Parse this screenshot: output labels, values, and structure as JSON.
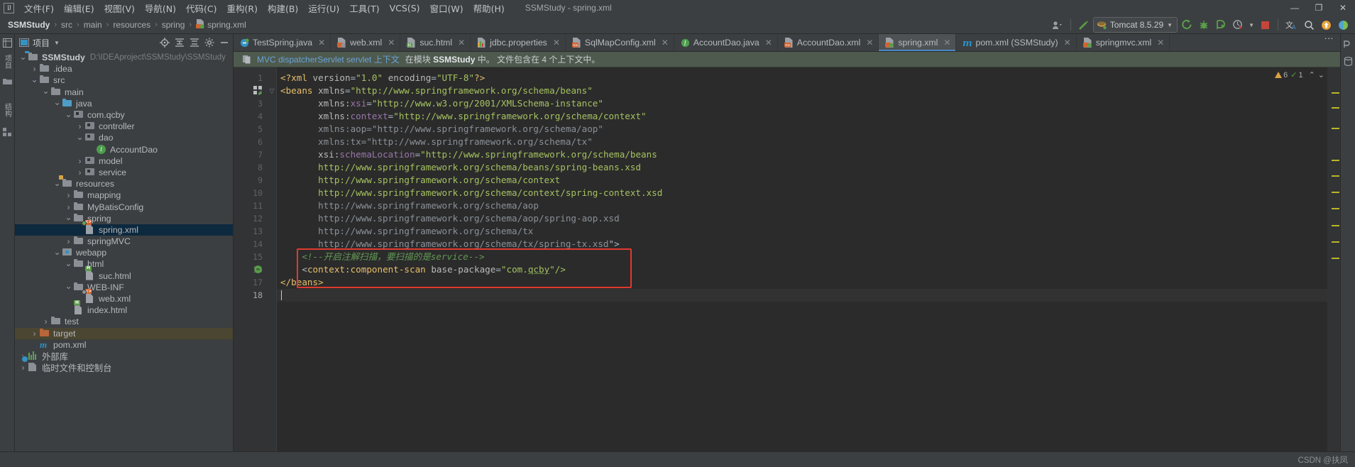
{
  "window": {
    "title": "SSMStudy - spring.xml",
    "logo": "intellij-idea-logo",
    "controls": {
      "minimize": "—",
      "maximize": "❐",
      "close": "✕"
    }
  },
  "menubar": {
    "items": [
      {
        "label": "文件(F)",
        "name": "menu-file"
      },
      {
        "label": "编辑(E)",
        "name": "menu-edit"
      },
      {
        "label": "视图(V)",
        "name": "menu-view"
      },
      {
        "label": "导航(N)",
        "name": "menu-navigate"
      },
      {
        "label": "代码(C)",
        "name": "menu-code"
      },
      {
        "label": "重构(R)",
        "name": "menu-refactor"
      },
      {
        "label": "构建(B)",
        "name": "menu-build"
      },
      {
        "label": "运行(U)",
        "name": "menu-run"
      },
      {
        "label": "工具(T)",
        "name": "menu-tools"
      },
      {
        "label": "VCS(S)",
        "name": "menu-vcs"
      },
      {
        "label": "窗口(W)",
        "name": "menu-window"
      },
      {
        "label": "帮助(H)",
        "name": "menu-help"
      }
    ]
  },
  "breadcrumb": {
    "items": [
      "SSMStudy",
      "src",
      "main",
      "resources",
      "spring",
      "spring.xml"
    ],
    "separator": "›"
  },
  "toolbar": {
    "run_config": "Tomcat 8.5.29",
    "buttons": [
      {
        "name": "user-settings-icon",
        "glyph": "⛭"
      },
      {
        "name": "build-hammer-icon",
        "glyph": "⚒"
      },
      {
        "name": "run-button",
        "glyph": "▶"
      },
      {
        "name": "debug-button",
        "glyph": "🐞"
      },
      {
        "name": "run-with-coverage-button",
        "glyph": "▷"
      },
      {
        "name": "profiler-button",
        "glyph": "◴"
      },
      {
        "name": "stop-button",
        "glyph": "■"
      },
      {
        "name": "translate-icon",
        "glyph": "文"
      },
      {
        "name": "search-everywhere-icon",
        "glyph": "🔍"
      },
      {
        "name": "update-available-icon",
        "glyph": "↑"
      },
      {
        "name": "theme-toggle-icon",
        "glyph": "◐"
      }
    ]
  },
  "left_tool_strip": {
    "items": [
      {
        "name": "sidebar-item-project",
        "label": "项目"
      },
      {
        "name": "sidebar-item-structure",
        "label": "结构"
      }
    ]
  },
  "right_tool_strip": {
    "items": [
      {
        "name": "sidebar-item-maven",
        "label": "Maven"
      },
      {
        "name": "sidebar-item-database",
        "label": "Database"
      }
    ]
  },
  "project_panel": {
    "title": "项目",
    "actions": [
      {
        "name": "locate-in-tree-icon",
        "glyph": "⊕"
      },
      {
        "name": "expand-all-icon",
        "glyph": "≣"
      },
      {
        "name": "collapse-all-icon",
        "glyph": "≡"
      },
      {
        "name": "settings-gear-icon",
        "glyph": "⚙"
      },
      {
        "name": "hide-panel-icon",
        "glyph": "—"
      }
    ],
    "tree": [
      {
        "label": "SSMStudy",
        "path": "D:\\IDEAproject\\SSMStudy\\SSMStudy",
        "depth": 0,
        "arrow": "down",
        "icon": "module-folder",
        "bold": true,
        "state": "normal"
      },
      {
        "label": ".idea",
        "depth": 1,
        "arrow": "right",
        "icon": "folder",
        "state": "normal"
      },
      {
        "label": "src",
        "depth": 1,
        "arrow": "down",
        "icon": "folder",
        "state": "normal"
      },
      {
        "label": "main",
        "depth": 2,
        "arrow": "down",
        "icon": "folder",
        "state": "normal"
      },
      {
        "label": "java",
        "depth": 3,
        "arrow": "down",
        "icon": "source-folder",
        "state": "normal"
      },
      {
        "label": "com.qcby",
        "depth": 4,
        "arrow": "down",
        "icon": "package",
        "state": "normal"
      },
      {
        "label": "controller",
        "depth": 5,
        "arrow": "right",
        "icon": "package",
        "state": "normal"
      },
      {
        "label": "dao",
        "depth": 5,
        "arrow": "down",
        "icon": "package",
        "state": "normal"
      },
      {
        "label": "AccountDao",
        "depth": 6,
        "arrow": "none",
        "icon": "interface",
        "state": "normal"
      },
      {
        "label": "model",
        "depth": 5,
        "arrow": "right",
        "icon": "package",
        "state": "normal"
      },
      {
        "label": "service",
        "depth": 5,
        "arrow": "right",
        "icon": "package",
        "state": "normal"
      },
      {
        "label": "resources",
        "depth": 3,
        "arrow": "down",
        "icon": "resources-folder",
        "state": "normal"
      },
      {
        "label": "mapping",
        "depth": 4,
        "arrow": "right",
        "icon": "folder",
        "state": "normal"
      },
      {
        "label": "MyBatisConfig",
        "depth": 4,
        "arrow": "right",
        "icon": "folder",
        "state": "normal"
      },
      {
        "label": "spring",
        "depth": 4,
        "arrow": "down",
        "icon": "folder",
        "state": "normal"
      },
      {
        "label": "spring.xml",
        "depth": 5,
        "arrow": "none",
        "icon": "xml-spring-file",
        "state": "selected"
      },
      {
        "label": "springMVC",
        "depth": 4,
        "arrow": "right",
        "icon": "folder",
        "state": "normal"
      },
      {
        "label": "webapp",
        "depth": 3,
        "arrow": "down",
        "icon": "web-folder",
        "state": "normal"
      },
      {
        "label": "html",
        "depth": 4,
        "arrow": "down",
        "icon": "folder",
        "state": "normal"
      },
      {
        "label": "suc.html",
        "depth": 5,
        "arrow": "none",
        "icon": "html-file",
        "state": "normal"
      },
      {
        "label": "WEB-INF",
        "depth": 4,
        "arrow": "down",
        "icon": "folder",
        "state": "normal"
      },
      {
        "label": "web.xml",
        "depth": 5,
        "arrow": "none",
        "icon": "xml-web-file",
        "state": "normal"
      },
      {
        "label": "index.html",
        "depth": 4,
        "arrow": "none",
        "icon": "html-file",
        "state": "normal"
      },
      {
        "label": "test",
        "depth": 2,
        "arrow": "right",
        "icon": "folder",
        "state": "normal"
      },
      {
        "label": "target",
        "depth": 1,
        "arrow": "right",
        "icon": "excluded-folder",
        "state": "marked"
      },
      {
        "label": "pom.xml",
        "depth": 1,
        "arrow": "none",
        "icon": "maven-file",
        "state": "normal"
      },
      {
        "label": "外部库",
        "depth": 0,
        "arrow": "right",
        "icon": "libraries",
        "state": "normal"
      },
      {
        "label": "临时文件和控制台",
        "depth": 0,
        "arrow": "right",
        "icon": "scratches",
        "state": "normal"
      }
    ]
  },
  "editor_tabs": [
    {
      "label": "TestSpring.java",
      "icon": "java-class-test-icon",
      "active": false
    },
    {
      "label": "web.xml",
      "icon": "xml-web-icon",
      "active": false
    },
    {
      "label": "suc.html",
      "icon": "html-icon",
      "active": false
    },
    {
      "label": "jdbc.properties",
      "icon": "properties-icon",
      "active": false
    },
    {
      "label": "SqlMapConfig.xml",
      "icon": "xml-mybatis-icon",
      "active": false
    },
    {
      "label": "AccountDao.java",
      "icon": "java-interface-icon",
      "active": false
    },
    {
      "label": "AccountDao.xml",
      "icon": "xml-mapper-icon",
      "active": false
    },
    {
      "label": "spring.xml",
      "icon": "xml-spring-icon",
      "active": true
    },
    {
      "label": "pom.xml (SSMStudy)",
      "icon": "maven-icon",
      "active": false
    },
    {
      "label": "springmvc.xml",
      "icon": "xml-spring-icon",
      "active": false
    }
  ],
  "notice_bar": {
    "icon": "spring-context-icon",
    "link": "MVC dispatcherServlet servlet 上下文",
    "text_prefix": "在模块 ",
    "module": "SSMStudy",
    "text_suffix": " 中。 文件包含在 4 个上下文中。"
  },
  "inspection_widget": {
    "warnings": "6",
    "checks": "1",
    "up_arrow": "⌃",
    "down_arrow": "⌄"
  },
  "editor": {
    "caret_line": 18,
    "highlight_box": {
      "from_line": 15,
      "to_line": 17
    },
    "lines": [
      {
        "n": 1,
        "tokens": [
          {
            "t": "<?xml ",
            "c": "t-tag"
          },
          {
            "t": "version",
            "c": "t-attr"
          },
          {
            "t": "=",
            "c": "t-punct"
          },
          {
            "t": "\"1.0\"",
            "c": "t-val"
          },
          {
            "t": " ",
            "c": "t-plain"
          },
          {
            "t": "encoding",
            "c": "t-attr"
          },
          {
            "t": "=",
            "c": "t-punct"
          },
          {
            "t": "\"UTF-8\"",
            "c": "t-val"
          },
          {
            "t": "?>",
            "c": "t-tag"
          }
        ]
      },
      {
        "n": 2,
        "tokens": [
          {
            "t": "<beans ",
            "c": "t-tag"
          },
          {
            "t": "xmlns",
            "c": "t-attr"
          },
          {
            "t": "=",
            "c": "t-punct"
          },
          {
            "t": "\"http://www.springframework.org/schema/beans\"",
            "c": "t-val"
          }
        ]
      },
      {
        "n": 3,
        "tokens": [
          {
            "t": "       ",
            "c": "t-plain"
          },
          {
            "t": "xmlns:",
            "c": "t-attr"
          },
          {
            "t": "xsi",
            "c": "t-attr-ns"
          },
          {
            "t": "=",
            "c": "t-punct"
          },
          {
            "t": "\"http://www.w3.org/2001/XMLSchema-instance\"",
            "c": "t-val"
          }
        ]
      },
      {
        "n": 4,
        "tokens": [
          {
            "t": "       ",
            "c": "t-plain"
          },
          {
            "t": "xmlns:",
            "c": "t-attr"
          },
          {
            "t": "context",
            "c": "t-attr-ns"
          },
          {
            "t": "=",
            "c": "t-punct"
          },
          {
            "t": "\"http://www.springframework.org/schema/context\"",
            "c": "t-val"
          }
        ]
      },
      {
        "n": 5,
        "tokens": [
          {
            "t": "       ",
            "c": "t-plain"
          },
          {
            "t": "xmlns:aop",
            "c": "t-url"
          },
          {
            "t": "=",
            "c": "t-url"
          },
          {
            "t": "\"http://www.springframework.org/schema/aop\"",
            "c": "t-url"
          }
        ]
      },
      {
        "n": 6,
        "tokens": [
          {
            "t": "       ",
            "c": "t-plain"
          },
          {
            "t": "xmlns:tx",
            "c": "t-url"
          },
          {
            "t": "=",
            "c": "t-url"
          },
          {
            "t": "\"http://www.springframework.org/schema/tx\"",
            "c": "t-url"
          }
        ]
      },
      {
        "n": 7,
        "tokens": [
          {
            "t": "       ",
            "c": "t-plain"
          },
          {
            "t": "xsi:",
            "c": "t-attr"
          },
          {
            "t": "schemaLocation",
            "c": "t-attr-ns"
          },
          {
            "t": "=",
            "c": "t-punct"
          },
          {
            "t": "\"http://www.springframework.org/schema/beans",
            "c": "t-val"
          }
        ]
      },
      {
        "n": 8,
        "tokens": [
          {
            "t": "       http://www.springframework.org/schema/beans/spring-beans.xsd",
            "c": "t-val"
          }
        ]
      },
      {
        "n": 9,
        "tokens": [
          {
            "t": "       http://www.springframework.org/schema/context",
            "c": "t-val"
          }
        ]
      },
      {
        "n": 10,
        "tokens": [
          {
            "t": "       http://www.springframework.org/schema/context/spring-context.xsd",
            "c": "t-val"
          }
        ]
      },
      {
        "n": 11,
        "tokens": [
          {
            "t": "       http://www.springframework.org/schema/aop",
            "c": "t-url"
          }
        ]
      },
      {
        "n": 12,
        "tokens": [
          {
            "t": "       http://www.springframework.org/schema/aop/spring-aop.xsd",
            "c": "t-url"
          }
        ]
      },
      {
        "n": 13,
        "tokens": [
          {
            "t": "       http://www.springframework.org/schema/tx",
            "c": "t-url"
          }
        ]
      },
      {
        "n": 14,
        "tokens": [
          {
            "t": "       http://www.springframework.org/schema/tx/spring-tx.xsd",
            "c": "t-url"
          },
          {
            "t": "\">",
            "c": "t-punct"
          }
        ]
      },
      {
        "n": 15,
        "tokens": [
          {
            "t": "    ",
            "c": "t-plain"
          },
          {
            "t": "<!--开启注解扫描，要扫描的是service-->",
            "c": "t-comment"
          }
        ]
      },
      {
        "n": 16,
        "tokens": [
          {
            "t": "    ",
            "c": "t-plain"
          },
          {
            "t": "<",
            "c": "t-punct"
          },
          {
            "t": "context:component-scan ",
            "c": "t-tag"
          },
          {
            "t": "base-package",
            "c": "t-attr"
          },
          {
            "t": "=",
            "c": "t-punct"
          },
          {
            "t": "\"com.",
            "c": "t-val"
          },
          {
            "t": "qcby",
            "c": "t-underline"
          },
          {
            "t": "\"/>",
            "c": "t-val"
          }
        ]
      },
      {
        "n": 17,
        "tokens": [
          {
            "t": "</beans>",
            "c": "t-tag"
          }
        ]
      },
      {
        "n": 18,
        "tokens": []
      }
    ]
  },
  "status_bar": {
    "watermark": "CSDN @扶凤"
  },
  "colors": {
    "chrome": "#3c3f41",
    "editor_bg": "#2b2b2b",
    "gutter_bg": "#313335",
    "accent_blue": "#4a88c7",
    "selection": "#0d293e",
    "marked": "#4b4631",
    "notice_bg": "#4e5a4e",
    "red_box": "#e03a2f",
    "comment_green": "#629755",
    "string_green": "#a5c261",
    "tag_orange": "#e8bf6a",
    "ns_purple": "#9876aa"
  }
}
